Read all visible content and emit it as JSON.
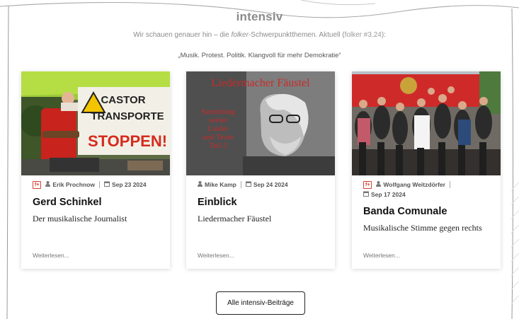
{
  "section": {
    "title": "intensiv",
    "intro_before": "Wir schauen genauer hin – die ",
    "intro_em": "folker",
    "intro_mid": "-Schwerpunktthemen. Aktuell (",
    "intro_link": "folker #3.24",
    "intro_after": "):",
    "quote": "„Musik. Protest. Politik. Klangvoll für mehr Demokratie“"
  },
  "cards": [
    {
      "badge": "f+",
      "author": "Erik Prochnow",
      "date": "Sep 23 2024",
      "title": "Gerd Schinkel",
      "subtitle": "Der musikalische Journalist",
      "more": "Weiterlesen...",
      "image_text": [
        "CASTOR",
        "TRANSPORTE",
        "STOPPEN!"
      ]
    },
    {
      "badge": "",
      "author": "Mike Kamp",
      "date": "Sep 24 2024",
      "title": "Einblick",
      "subtitle": "Liedermacher Fäustel",
      "more": "Weiterlesen...",
      "image_text": [
        "Liedermacher Fäustel",
        "Sammlung",
        "seiner",
        "Lieder",
        "und Texte",
        "Teil 2"
      ]
    },
    {
      "badge": "f+",
      "author": "Wolfgang Weitzdörfer",
      "date": "Sep 17 2024",
      "title": "Banda Comunale",
      "subtitle": "Musikalische Stimme gegen rechts",
      "more": "Weiterlesen..."
    }
  ],
  "all_button": "Alle intensiv-Beiträge",
  "icons": {
    "author": "user-icon",
    "date": "calendar-icon"
  },
  "colors": {
    "badge": "#d8412f",
    "title": "#111111",
    "muted": "#8c8c8c"
  }
}
